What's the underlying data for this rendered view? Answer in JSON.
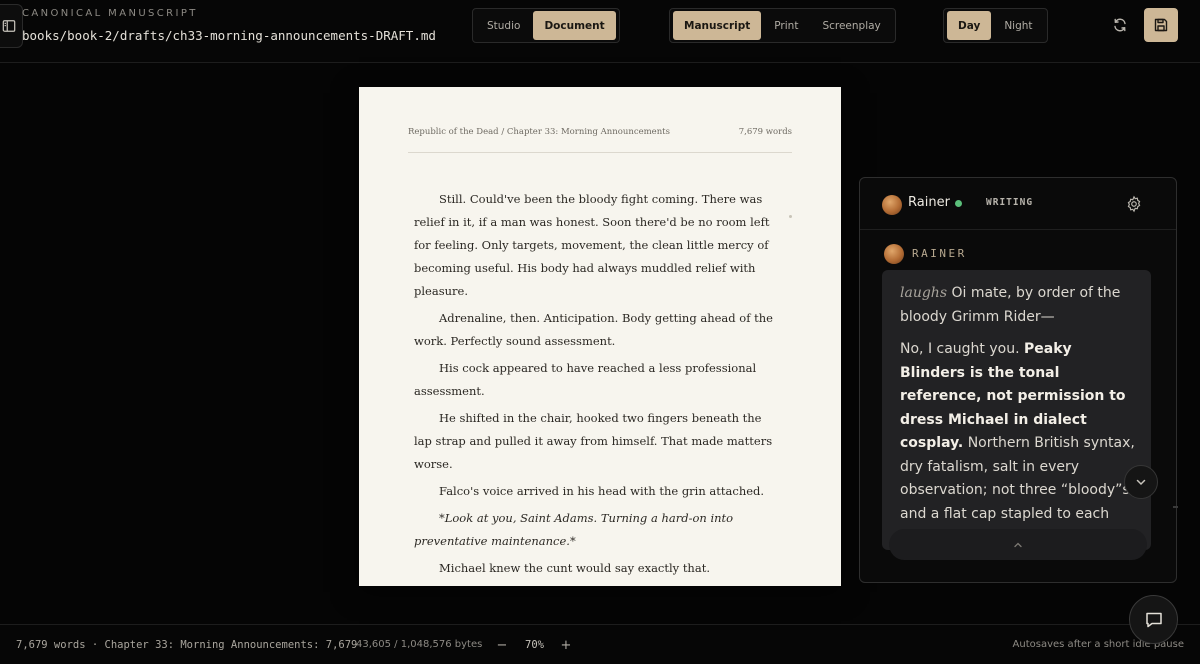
{
  "header": {
    "eyebrow": "CANONICAL MANUSCRIPT",
    "file_path": "books/book-2/drafts/ch33-morning-announcements-DRAFT.md",
    "view_tabs": [
      {
        "label": "Studio",
        "active": false
      },
      {
        "label": "Document",
        "active": true
      }
    ],
    "format_tabs": [
      {
        "label": "Manuscript",
        "active": true
      },
      {
        "label": "Print",
        "active": false
      },
      {
        "label": "Screenplay",
        "active": false
      }
    ],
    "theme_tabs": [
      {
        "label": "Day",
        "active": true
      },
      {
        "label": "Night",
        "active": false
      }
    ],
    "icons": {
      "sidebar": "sidebar-toggle-icon",
      "refresh": "refresh-icon",
      "save": "save-icon"
    }
  },
  "page": {
    "running_head": "Republic of the Dead / Chapter 33: Morning Announcements",
    "word_count": "7,679 words",
    "paragraphs": [
      "Still. Could've been the bloody fight coming. There was relief in it, if a man was honest. Soon there'd be no room left for feeling. Only targets, movement, the clean little mercy of becoming useful. His body had always muddled relief with pleasure.",
      "Adrenaline, then. Anticipation. Body getting ahead of the work. Perfectly sound assessment.",
      "His cock appeared to have reached a less professional assessment.",
      "He shifted in the chair, hooked two fingers beneath the lap strap and pulled it away from himself. That made matters worse.",
      "Falco's voice arrived in his head with the grin attached.",
      "*Look at you, Saint Adams. Turning a hard-on into preventative maintenance.*",
      "Michael knew the cunt would say exactly that."
    ]
  },
  "chat": {
    "agent_name": "Rainer",
    "status_color": "#5bbf7a",
    "mode": "WRITING",
    "speaker": "RAINER",
    "message": {
      "p1_em": "laughs",
      "p1_text": " Oi mate, by order of the bloody Grimm Rider—",
      "p2_lead": "No, I caught you. ",
      "p2_strong": "Peaky Blinders is the tonal reference, not permission to dress Michael in dialect cosplay.",
      "p2_rest": " Northern British syntax, dry fatalism, salt in every observation; not three “bloody”s and a flat cap stapled to each paragraph."
    },
    "icons": {
      "settings": "gear-icon",
      "scroll_down": "chevron-down-icon",
      "expand": "chevron-up-icon",
      "open_chat": "chat-bubble-icon"
    }
  },
  "footer": {
    "word_summary": "7,679 words · Chapter 33: Morning Announcements: 7,679",
    "bytes": "43,605 / 1,048,576 bytes",
    "zoom_out": "−",
    "zoom": "70%",
    "zoom_in": "+",
    "autosave": "Autosaves after a short idle pause"
  },
  "colors": {
    "accent": "#cdb796",
    "background": "#050505",
    "paper": "#f7f5ee"
  }
}
